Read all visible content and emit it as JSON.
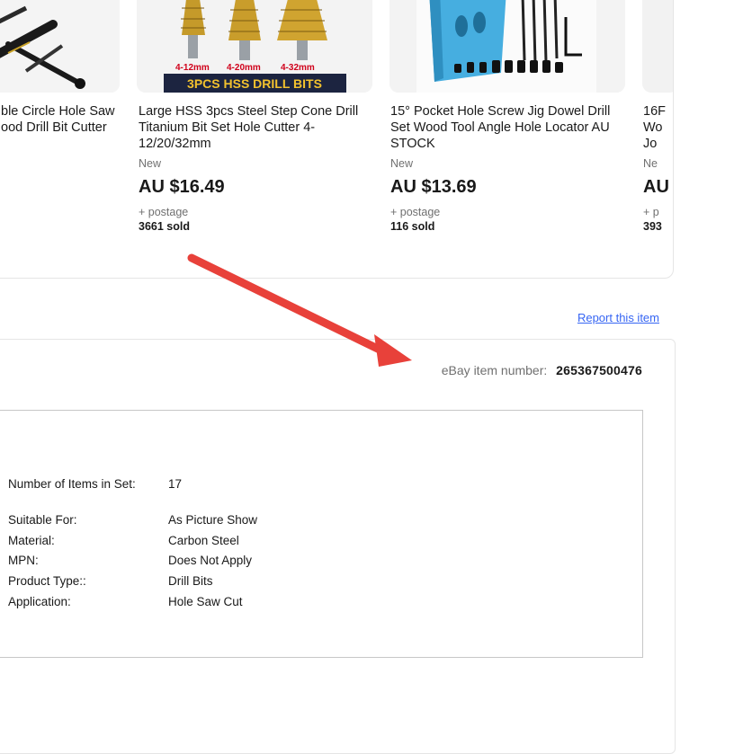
{
  "carousel": {
    "items": [
      {
        "title_line1": "ble Circle Hole Saw",
        "title_line2": "ood Drill Bit Cutter"
      },
      {
        "title": "Large HSS 3pcs Steel Step Cone Drill Titanium Bit Set Hole Cutter 4-12/20/32mm",
        "condition": "New",
        "price": "AU $16.49",
        "postage": "+ postage",
        "sold": "3661 sold",
        "image_banner": "3PCS HSS DRILL BITS",
        "image_sizes": [
          "4-12mm",
          "4-20mm",
          "4-32mm"
        ]
      },
      {
        "title": "15° Pocket Hole Screw Jig Dowel Drill Set Wood Tool Angle Hole Locator AU STOCK",
        "condition": "New",
        "price": "AU $13.69",
        "postage": "+ postage",
        "sold": "116 sold"
      },
      {
        "title_line1": "16F",
        "title_line2": "Wo",
        "title_line3": "Jo",
        "condition": "Ne",
        "price": "AU",
        "postage": "+ p",
        "sold": "393"
      }
    ]
  },
  "report_link": "Report this item",
  "item_number": {
    "label": "eBay item number:",
    "value": "265367500476"
  },
  "specifics": [
    {
      "label": "Number of Items in Set:",
      "value": "17"
    },
    {
      "label": "Suitable For:",
      "value": "As Picture Show"
    },
    {
      "label": "Material:",
      "value": "Carbon Steel"
    },
    {
      "label": "MPN:",
      "value": "Does Not Apply"
    },
    {
      "label": "Product Type::",
      "value": "Drill Bits"
    },
    {
      "label": "Application:",
      "value": "Hole Saw Cut"
    }
  ],
  "colors": {
    "link": "#3665f3",
    "annotation_arrow": "#e8413a",
    "banner_bg": "#1c2440",
    "banner_text": "#f2c12e",
    "size_text": "#d0021b",
    "jig_blue": "#46aee0"
  }
}
